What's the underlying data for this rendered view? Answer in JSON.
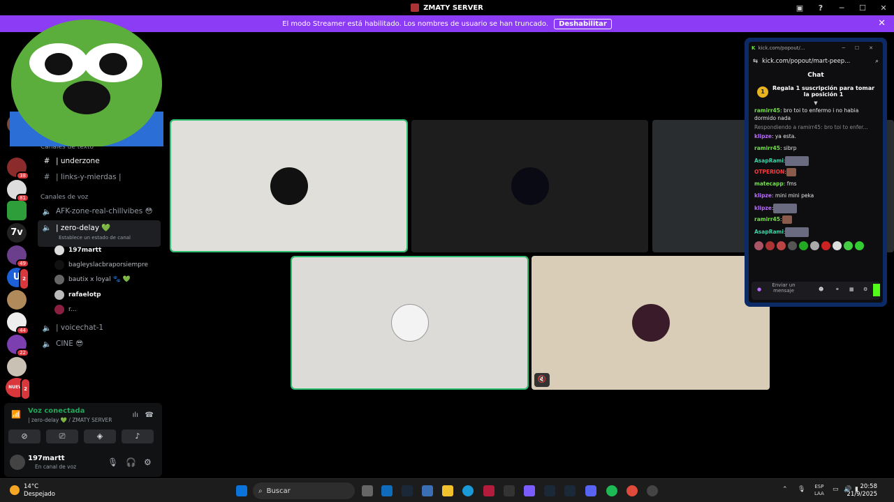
{
  "window": {
    "title": "ZMATY SERVER"
  },
  "banner": {
    "text": "El modo Streamer está habilitado. Los nombres de usuario se han truncado.",
    "button": "Deshabilitar"
  },
  "guild_badges": [
    "314",
    "38",
    "81",
    "49",
    "2",
    "44",
    "22",
    "NUEVO",
    "2"
  ],
  "sidebar": {
    "text_category": "Canales de texto",
    "text_channels": [
      "| underzone",
      "|  links-y-mierdas |"
    ],
    "voice_category": "Canales de voz",
    "voice_channels": [
      "AFK-zone-real-chillvibes 😳",
      "| zero-delay 💚",
      "| voicechat-1",
      "CINE 😎"
    ],
    "selected_status": "Establece un estado de canal",
    "members": [
      "197martt",
      "bagleyslacbraporsiempre",
      "bautix x loyal 🐾 💚",
      "rafaelotp",
      "r..."
    ]
  },
  "voice_panel": {
    "title": "Voz conectada",
    "subtitle": "| zero-delay 💚 / ZMATY SERVER",
    "user": "197martt",
    "user_status": "En canal de voz"
  },
  "popout": {
    "window_title": "kick.com/popout/...",
    "url": "kick.com/popout/mart-peep...",
    "chat_title": "Chat",
    "gift_text": "Regala 1 suscripción para tomar la posición 1",
    "gift_number": "1",
    "messages": [
      {
        "user": "ramirr45",
        "text": ": bro toi to enfermo i no habia dormido nada",
        "color": "#72e04a"
      },
      {
        "user": "",
        "text": "Respondiendo a ramirr45: bro toi to enfer...",
        "color": "#8a8a8a",
        "reply": true
      },
      {
        "user": "klipze",
        "text": ": ya esta.",
        "color": "#b96bff"
      },
      {
        "user": "ramirr45",
        "text": ": sibrp",
        "color": "#72e04a"
      },
      {
        "user": "AsapRami",
        "text": ":",
        "color": "#3fd1a8"
      },
      {
        "user": "OTPERION",
        "text": ":",
        "color": "#ff3a3a"
      },
      {
        "user": "matecapp",
        "text": ": fms",
        "color": "#72e04a"
      },
      {
        "user": "klipze",
        "text": ": mini mini peka",
        "color": "#b96bff"
      },
      {
        "user": "klipze",
        "text": ":",
        "color": "#b96bff"
      },
      {
        "user": "ramirr45",
        "text": ":",
        "color": "#72e04a"
      },
      {
        "user": "AsapRami",
        "text": ":",
        "color": "#3fd1a8"
      }
    ],
    "input_placeholder": "Enviar un mensaje"
  },
  "taskbar": {
    "temperature": "14°C",
    "weather": "Despejado",
    "search": "Buscar",
    "lang1": "ESP",
    "lang2": "LAA",
    "time": "20:58",
    "date": "21/9/2025"
  }
}
